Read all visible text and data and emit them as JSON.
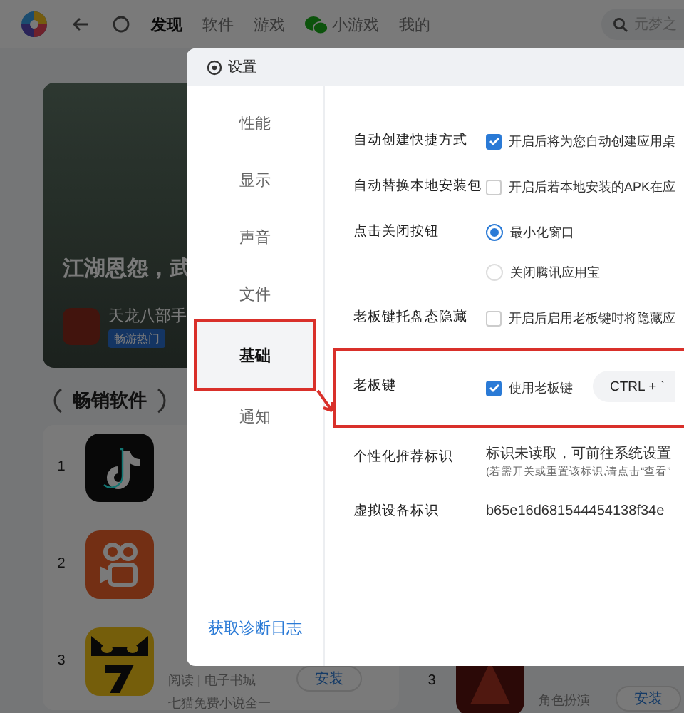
{
  "topbar": {
    "tabs": [
      {
        "label": "发现",
        "selected": true,
        "kind": "text"
      },
      {
        "label": "软件",
        "selected": false,
        "kind": "text"
      },
      {
        "label": "游戏",
        "selected": false,
        "kind": "text"
      },
      {
        "label": "小游戏",
        "selected": false,
        "kind": "wechat"
      },
      {
        "label": "我的",
        "selected": false,
        "kind": "text"
      }
    ],
    "search": {
      "placeholder": "元梦之"
    }
  },
  "banner": {
    "headline": "江湖恩怨，武",
    "game": "天龙八部手",
    "badge": "畅游热门"
  },
  "bestsellers": {
    "title": "畅销软件",
    "left": [
      {
        "rank": "1",
        "kind": "music"
      },
      {
        "rank": "2",
        "kind": "camera"
      },
      {
        "rank": "3",
        "kind": "cat",
        "category": "阅读 | 电子书城",
        "desc": "七猫免费小说全一",
        "action": "安装"
      }
    ],
    "right": [
      {
        "rank": "3",
        "kind": "game",
        "category": "角色扮演",
        "action": "安装"
      }
    ]
  },
  "dialog": {
    "title": "设置",
    "nav": [
      {
        "label": "性能",
        "selected": false,
        "annotated": false
      },
      {
        "label": "显示",
        "selected": false,
        "annotated": false
      },
      {
        "label": "声音",
        "selected": false,
        "annotated": false
      },
      {
        "label": "文件",
        "selected": false,
        "annotated": false
      },
      {
        "label": "基础",
        "selected": true,
        "annotated": true
      },
      {
        "label": "通知",
        "selected": false,
        "annotated": false
      }
    ],
    "link": "获取诊断日志",
    "settings": [
      {
        "label": "自动创建快捷方式",
        "annotated": false,
        "options": [
          {
            "kind": "checkbox",
            "checked": true,
            "text": "开启后将为您自动创建应用桌"
          }
        ]
      },
      {
        "label": "自动替换本地安装包",
        "annotated": false,
        "options": [
          {
            "kind": "checkbox",
            "checked": false,
            "text": "开启后若本地安装的APK在应"
          }
        ]
      },
      {
        "label": "点击关闭按钮",
        "annotated": false,
        "options": [
          {
            "kind": "radio",
            "selected": true,
            "text": "最小化窗口"
          },
          {
            "kind": "radio",
            "selected": false,
            "text": "关闭腾讯应用宝"
          }
        ]
      },
      {
        "label": "老板键托盘态隐藏",
        "annotated": false,
        "options": [
          {
            "kind": "checkbox",
            "checked": false,
            "text": "开启后启用老板键时将隐藏应"
          }
        ]
      },
      {
        "label": "老板键",
        "annotated": true,
        "options": [
          {
            "kind": "checkbox",
            "checked": true,
            "text": "使用老板键"
          }
        ],
        "hotkey": "CTRL + `"
      },
      {
        "label": "个性化推荐标识",
        "annotated": false,
        "options": [
          {
            "kind": "note",
            "text": "标识未读取，可前往系统设置",
            "sub": "(若需开关或重置该标识,请点击“查看”"
          }
        ]
      },
      {
        "label": "虚拟设备标识",
        "annotated": false,
        "options": [
          {
            "kind": "value",
            "text": "b65e16d681544454138f34e"
          }
        ]
      }
    ]
  }
}
